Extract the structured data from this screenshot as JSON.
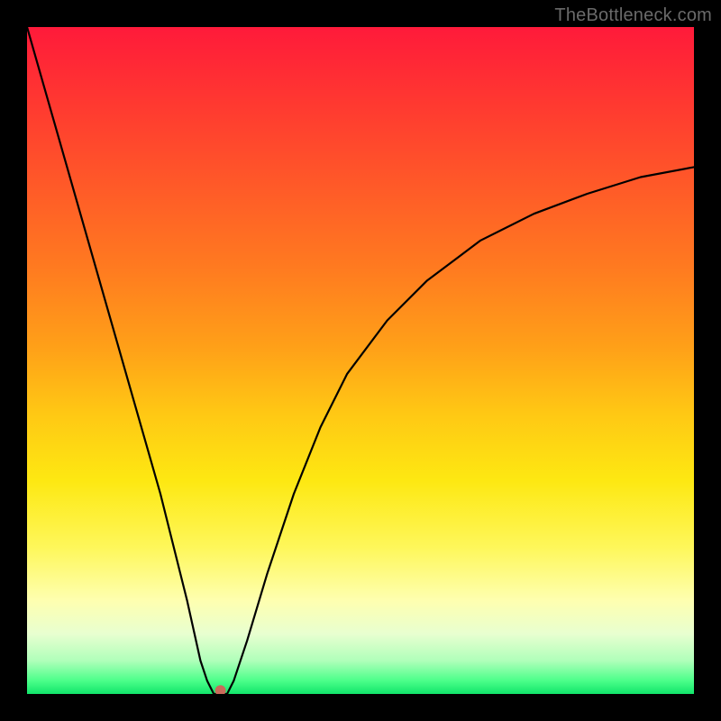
{
  "watermark": {
    "text": "TheBottleneck.com"
  },
  "chart_data": {
    "type": "line",
    "title": "",
    "xlabel": "",
    "ylabel": "",
    "xlim": [
      0,
      100
    ],
    "ylim": [
      0,
      100
    ],
    "gradient_stops": [
      {
        "pos": 0.0,
        "color": "#ff1a3a",
        "label": "red"
      },
      {
        "pos": 0.36,
        "color": "#ff7a20",
        "label": "orange"
      },
      {
        "pos": 0.68,
        "color": "#fde812",
        "label": "yellow"
      },
      {
        "pos": 0.92,
        "color": "#e8ffd0",
        "label": "pale-yellow-green"
      },
      {
        "pos": 1.0,
        "color": "#11e56a",
        "label": "green"
      }
    ],
    "series": [
      {
        "name": "curve",
        "color": "#000000",
        "x": [
          0,
          4,
          8,
          12,
          16,
          20,
          24,
          26,
          27,
          28,
          29,
          30,
          31,
          33,
          36,
          40,
          44,
          48,
          54,
          60,
          68,
          76,
          84,
          92,
          100
        ],
        "y": [
          100,
          86,
          72,
          58,
          44,
          30,
          14,
          5,
          2,
          0,
          0,
          0,
          2,
          8,
          18,
          30,
          40,
          48,
          56,
          62,
          68,
          72,
          75,
          77.5,
          79
        ]
      }
    ],
    "marker": {
      "name": "minimum-dot",
      "x": 29,
      "y": 0.5,
      "color": "#c96a5a",
      "radius_px": 6
    }
  }
}
